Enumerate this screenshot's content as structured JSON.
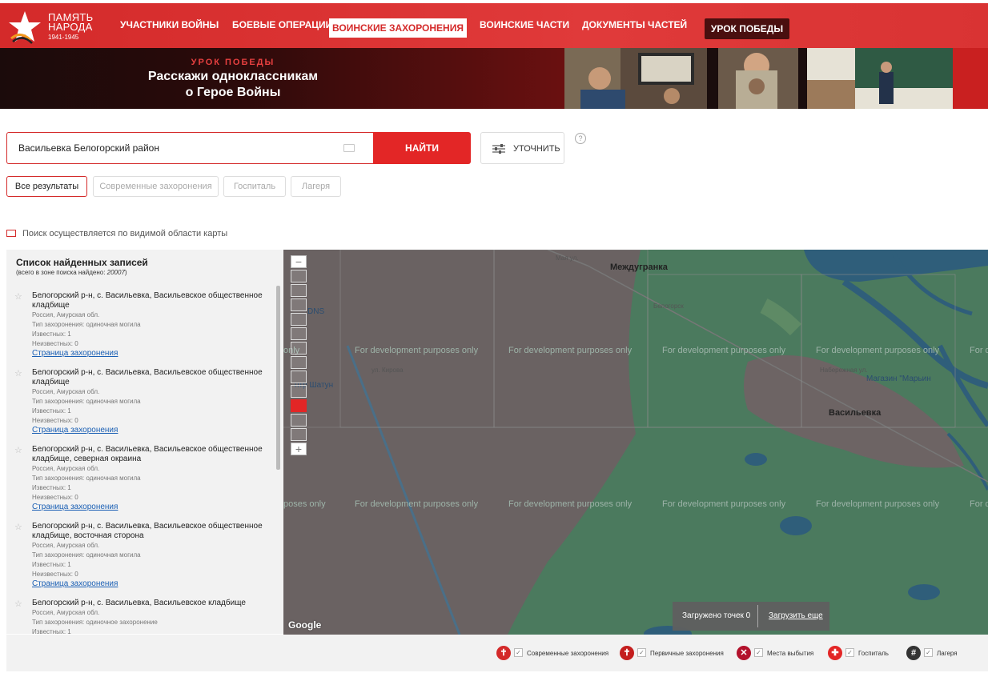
{
  "header": {
    "logo_line1": "ПАМЯТЬ",
    "logo_line2": "НАРОДА",
    "logo_years": "1941-1945",
    "nav": [
      "УЧАСТНИКИ ВОЙНЫ",
      "БОЕВЫЕ ОПЕРАЦИИ",
      "ВОИНСКИЕ ЗАХОРОНЕНИЯ",
      "ВОИНСКИЕ ЧАСТИ",
      "ДОКУМЕНТЫ ЧАСТЕЙ"
    ],
    "lesson_button": "УРОК ПОБЕДЫ",
    "accent": "#e32626"
  },
  "banner": {
    "kicker": "УРОК ПОБЕДЫ",
    "title_line1": "Расскажи одноклассникам",
    "title_line2": "о Герое Войны"
  },
  "search": {
    "query": "Васильевка Белогорский район",
    "button": "НАЙТИ",
    "refine": "УТОЧНИТЬ",
    "help": "?"
  },
  "filters": [
    "Все результаты",
    "Современные захоронения",
    "Госпиталь",
    "Лагеря"
  ],
  "notice": "Поиск осуществляется по видимой области карты",
  "results": {
    "title": "Список найденных записей",
    "count_prefix": "(всего в зоне поиска найдено: ",
    "count": "20007",
    "count_suffix": ")",
    "items": [
      {
        "title": "Белогорский р-н, с. Васильевка, Васильевское общественное кладбище",
        "region": "Россия, Амурская обл.",
        "type": "Тип захоронения: одиночная могила",
        "known": "Известных: 1",
        "unknown": "Неизвестных: 0",
        "link": "Страница захоронения"
      },
      {
        "title": "Белогорский р-н, с. Васильевка, Васильевское общественное кладбище",
        "region": "Россия, Амурская обл.",
        "type": "Тип захоронения: одиночная могила",
        "known": "Известных: 1",
        "unknown": "Неизвестных: 0",
        "link": "Страница захоронения"
      },
      {
        "title": "Белогорский р-н, с. Васильевка, Васильевское общественное кладбище, северная окраина",
        "region": "Россия, Амурская обл.",
        "type": "Тип захоронения: одиночная могила",
        "known": "Известных: 1",
        "unknown": "Неизвестных: 0",
        "link": "Страница захоронения"
      },
      {
        "title": "Белогорский р-н, с. Васильевка, Васильевское общественное кладбище, восточная сторона",
        "region": "Россия, Амурская обл.",
        "type": "Тип захоронения: одиночная могила",
        "known": "Известных: 1",
        "unknown": "Неизвестных: 0",
        "link": "Страница захоронения"
      },
      {
        "title": "Белогорский р-н, с. Васильевка, Васильевское кладбище",
        "region": "Россия, Амурская обл.",
        "type": "Тип захоронения: одиночное захоронение",
        "known": "Известных: 1",
        "unknown": "",
        "link": ""
      }
    ]
  },
  "map": {
    "dev_text": "For development purposes only",
    "dev_text_cut_right": "For d",
    "dev_text_cut_a": "only",
    "dev_text_cut_b": "poses only",
    "places": [
      "Междугранка",
      "Васильевка"
    ],
    "pois": [
      "DNS",
      "нтр Шатун",
      "Магазин \"Марьин"
    ],
    "roads": [
      "Мая ул.",
      "ул. Кирова",
      "Рабочая ул.",
      "Белогорск",
      "Набережная ул."
    ],
    "google": "Google",
    "zoom_in": "+",
    "zoom_out": "−",
    "loaded_label": "Загружено точек 0",
    "load_more": "Загрузить еще"
  },
  "legend": [
    {
      "label": "Современные захоронения",
      "color": "#d42a2a",
      "icon": "cross-grave-icon"
    },
    {
      "label": "Первичные захоронения",
      "color": "#c41e1e",
      "icon": "cross-icon"
    },
    {
      "label": "Места выбытия",
      "color": "#b3122c",
      "icon": "x-mark-icon"
    },
    {
      "label": "Госпиталь",
      "color": "#e32626",
      "icon": "medical-cross-icon"
    },
    {
      "label": "Лагеря",
      "color": "#333333",
      "icon": "barbed-wire-icon"
    }
  ]
}
